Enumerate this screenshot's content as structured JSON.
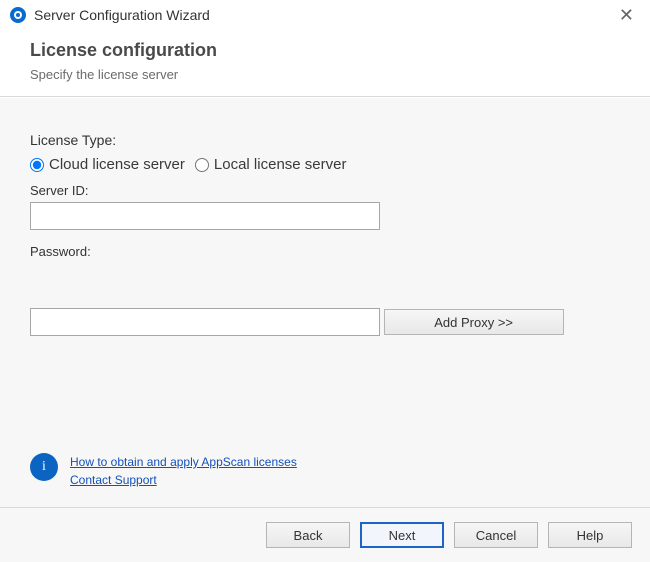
{
  "window": {
    "title": "Server Configuration Wizard"
  },
  "header": {
    "title": "License configuration",
    "subtitle": "Specify the license server"
  },
  "form": {
    "licenseTypeLabel": "License Type:",
    "radios": {
      "cloud": "Cloud license server",
      "local": "Local license server"
    },
    "serverIdLabel": "Server ID:",
    "serverIdValue": "",
    "passwordLabel": "Password:",
    "passwordValue": "",
    "addProxy": "Add Proxy >>"
  },
  "info": {
    "licensesLink": "How to obtain and apply AppScan licenses",
    "supportLink": "Contact Support"
  },
  "footer": {
    "back": "Back",
    "next": "Next",
    "cancel": "Cancel",
    "help": "Help"
  }
}
